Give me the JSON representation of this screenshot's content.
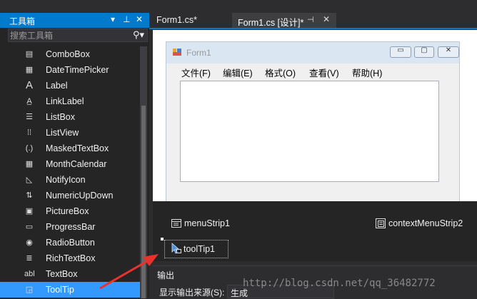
{
  "toolbox": {
    "title": "工具箱",
    "dropdown_glyph": "▾",
    "pin_glyph": "⊥",
    "close_glyph": "✕",
    "search_placeholder": "搜索工具箱",
    "items": [
      {
        "label": "ComboBox",
        "icon": "combobox-icon"
      },
      {
        "label": "DateTimePicker",
        "icon": "datetimepicker-icon"
      },
      {
        "label": "Label",
        "icon": "label-icon"
      },
      {
        "label": "LinkLabel",
        "icon": "linklabel-icon"
      },
      {
        "label": "ListBox",
        "icon": "listbox-icon"
      },
      {
        "label": "ListView",
        "icon": "listview-icon"
      },
      {
        "label": "MaskedTextBox",
        "icon": "maskedtextbox-icon"
      },
      {
        "label": "MonthCalendar",
        "icon": "monthcalendar-icon"
      },
      {
        "label": "NotifyIcon",
        "icon": "notifyicon-icon"
      },
      {
        "label": "NumericUpDown",
        "icon": "numericupdown-icon"
      },
      {
        "label": "PictureBox",
        "icon": "picturebox-icon"
      },
      {
        "label": "ProgressBar",
        "icon": "progressbar-icon"
      },
      {
        "label": "RadioButton",
        "icon": "radiobutton-icon"
      },
      {
        "label": "RichTextBox",
        "icon": "richtextbox-icon"
      },
      {
        "label": "TextBox",
        "icon": "textbox-icon"
      },
      {
        "label": "ToolTip",
        "icon": "tooltip-icon",
        "selected": true
      }
    ]
  },
  "tabs": [
    {
      "label": "Form1.cs*"
    },
    {
      "label": "Form1.cs [设计]*",
      "active": true
    }
  ],
  "tab_glyphs": {
    "pin": "⊣",
    "close": "✕"
  },
  "form": {
    "title": "Form1",
    "min_glyph": "▭",
    "max_glyph": "▢",
    "close_glyph": "✕",
    "menu": [
      "文件(F)",
      "编辑(E)",
      "格式(O)",
      "查看(V)",
      "帮助(H)"
    ]
  },
  "tray": {
    "menu_strip": "menuStrip1",
    "context_menu_strip": "contextMenuStrip2",
    "tool_tip": "toolTip1"
  },
  "output": {
    "title": "输出",
    "source_label": "显示输出来源(S):",
    "source_value": "生成"
  },
  "watermark": "http://blog.csdn.net/qq_36482772",
  "colors": {
    "accent": "#007acc",
    "selection": "#3399ff",
    "arrow": "#e8322e",
    "toolbox_bg": "#252526",
    "chrome_bg": "#2d2d30"
  }
}
